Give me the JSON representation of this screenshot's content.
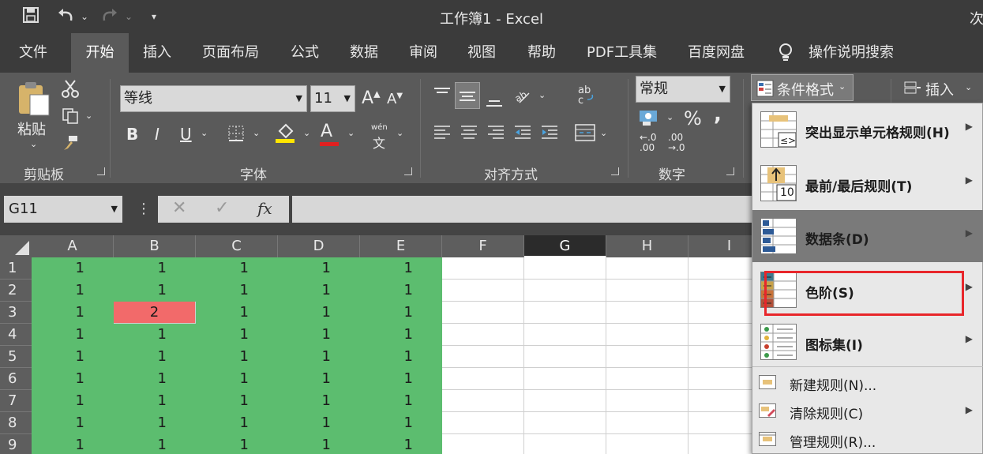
{
  "title_bar": {
    "title": "工作簿1  -  Excel",
    "cut_text": "次",
    "qa_save_icon": "save-icon",
    "qa_undo_icon": "undo-icon",
    "qa_redo_icon": "redo-icon",
    "qa_customize_icon": "customize-icon"
  },
  "menu": {
    "tabs": [
      "文件",
      "开始",
      "插入",
      "页面布局",
      "公式",
      "数据",
      "审阅",
      "视图",
      "帮助",
      "PDF工具集",
      "百度网盘"
    ],
    "active_tab": "开始",
    "search_label": "操作说明搜索"
  },
  "ribbon": {
    "clipboard": {
      "paste_label": "粘贴",
      "group_label": "剪贴板"
    },
    "font": {
      "font_name": "等线",
      "font_size": "11",
      "group_label": "字体",
      "bold": "B",
      "italic": "I",
      "underline": "U",
      "grow": "A",
      "shrink": "A",
      "font_color_glyph": "A",
      "wen_top": "wén",
      "wen_bottom": "文"
    },
    "alignment": {
      "group_label": "对齐方式"
    },
    "number": {
      "format": "常规",
      "percent": "%",
      "comma": ",",
      "inc_decimal_top": "←.0",
      "inc_decimal_bottom": ".00",
      "dec_decimal_top": ".00",
      "dec_decimal_bottom": "→.0",
      "group_label": "数字"
    },
    "styles": {
      "conditional_format_label": "条件格式"
    },
    "cells": {
      "insert_label": "插入"
    }
  },
  "formula_bar": {
    "name_box": "G11",
    "fx_label": "fx"
  },
  "sheet": {
    "columns": [
      "A",
      "B",
      "C",
      "D",
      "E",
      "F",
      "G",
      "H",
      "I"
    ],
    "selected_column": "G",
    "rows": [
      "1",
      "2",
      "3",
      "4",
      "5",
      "6",
      "7",
      "8",
      "9"
    ],
    "values": [
      [
        "1",
        "1",
        "1",
        "1",
        "1"
      ],
      [
        "1",
        "1",
        "1",
        "1",
        "1"
      ],
      [
        "1",
        "2",
        "1",
        "1",
        "1"
      ],
      [
        "1",
        "1",
        "1",
        "1",
        "1"
      ],
      [
        "1",
        "1",
        "1",
        "1",
        "1"
      ],
      [
        "1",
        "1",
        "1",
        "1",
        "1"
      ],
      [
        "1",
        "1",
        "1",
        "1",
        "1"
      ],
      [
        "1",
        "1",
        "1",
        "1",
        "1"
      ],
      [
        "1",
        "1",
        "1",
        "1",
        "1"
      ]
    ],
    "fill_color_green": "#5cbd6f",
    "fill_color_red": "#f26a6a"
  },
  "cf_menu": {
    "items": [
      {
        "label": "突出显示单元格规则(H)",
        "icon": "highlight-cells-icon"
      },
      {
        "label": "最前/最后规则(T)",
        "icon": "top-bottom-icon",
        "icon_text": "10"
      },
      {
        "label": "数据条(D)",
        "icon": "data-bars-icon",
        "highlighted": true
      },
      {
        "label": "色阶(S)",
        "icon": "color-scales-icon",
        "annotated": true
      },
      {
        "label": "图标集(I)",
        "icon": "icon-sets-icon"
      }
    ],
    "small_items": [
      {
        "label": "新建规则(N)...",
        "icon": "new-rule-icon"
      },
      {
        "label": "清除规则(C)",
        "icon": "clear-rule-icon"
      },
      {
        "label": "管理规则(R)...",
        "icon": "manage-rule-icon"
      }
    ],
    "annotation_color": "#e8262b"
  }
}
